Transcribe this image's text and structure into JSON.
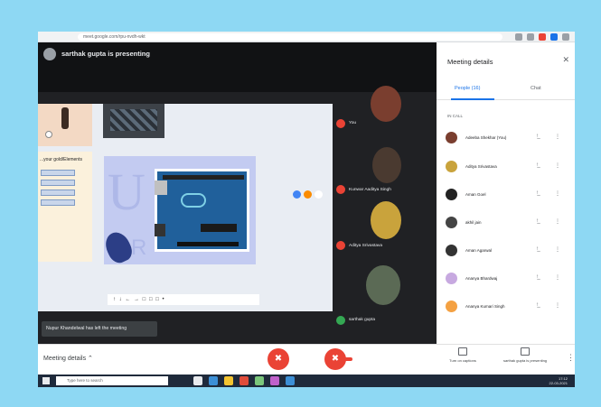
{
  "browser": {
    "url": "meet.google.com/rpu-nvdh-wkt",
    "icon_colors": [
      "#9aa0a6",
      "#9aa0a6",
      "#ea4335",
      "#1a73e8",
      "#9aa0a6"
    ]
  },
  "stage": {
    "presenter_text": "sarthak gupta is presenting",
    "doc_title": "...your gold/Elements",
    "toolbar_glyphs": "↑ ↓ ← → □ □ □ •",
    "toast": "Nupur Khandelwal has left the meeting",
    "reaction_colors": [
      "#4285f4",
      "#fb8c00",
      "#ffffff"
    ]
  },
  "tiles": [
    {
      "name": "You",
      "face_color": "#7a3e2f"
    },
    {
      "name": "Kunwar Aaditya Singh",
      "face_color": "#4a3a30"
    },
    {
      "name": "Aditya Srivastava",
      "face_color": "#c9a33c"
    },
    {
      "name": "sarthak gupta",
      "face_color": "#5b6a55"
    }
  ],
  "controls": {
    "meeting_details": "Meeting details",
    "chevron": "⌃",
    "mic_glyph": "✖",
    "cam_glyph": "✖",
    "turn_on_captions": "Turn on captions",
    "presenting_label": "sarthak gupta is presenting",
    "more_glyph": "⋮"
  },
  "panel": {
    "title": "Meeting details",
    "close": "✕",
    "tab_people": "People (16)",
    "tab_chat": "Chat",
    "section": "IN CALL",
    "pin_glyph": "↑̲",
    "more_glyph": "⋮",
    "people": [
      {
        "name": "Adeeba Shekhar (You)",
        "color": "#7a3e2f"
      },
      {
        "name": "Aditya Srivastava",
        "color": "#c9a33c"
      },
      {
        "name": "Aman Goel",
        "color": "#222222"
      },
      {
        "name": "akhil jain",
        "color": "#444444"
      },
      {
        "name": "Aman Agarwal",
        "color": "#333333"
      },
      {
        "name": "Ananya Bhardwaj",
        "color": "#c7a9e0"
      },
      {
        "name": "Ananya Kumari Singh",
        "color": "#f4a142"
      }
    ]
  },
  "taskbar": {
    "search_placeholder": "Type here to search",
    "app_colors": [
      "#e8eaed",
      "#3c8fd6",
      "#f4c430",
      "#e04c3b",
      "#7bc67b",
      "#c061cb",
      "#3c8fd6"
    ],
    "time": "17:12",
    "date": "22-03-2021"
  }
}
